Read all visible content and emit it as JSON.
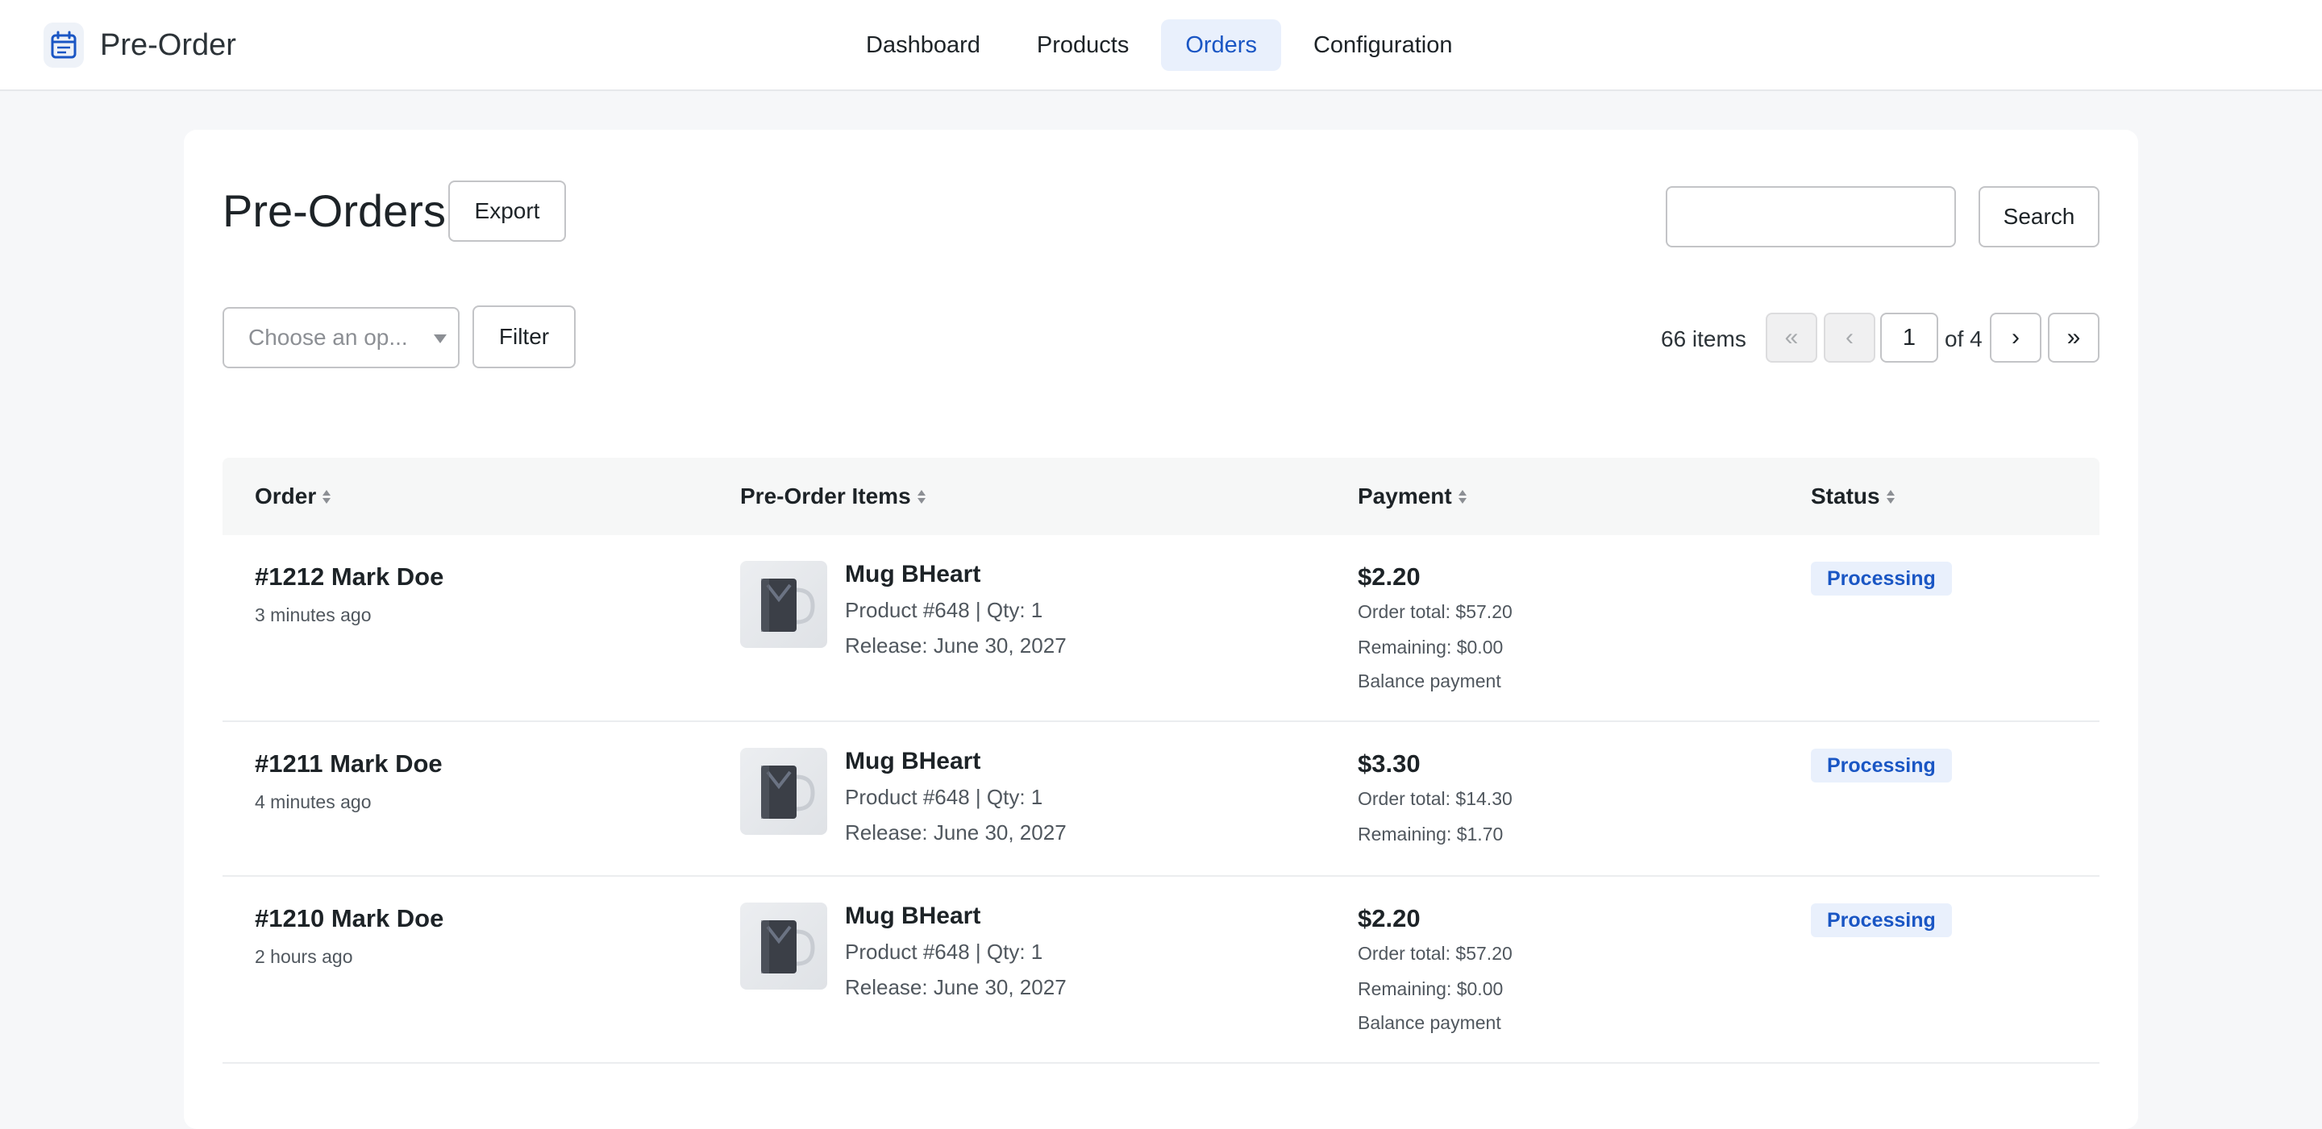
{
  "app": {
    "name": "Pre-Order",
    "icon": "calendar-icon",
    "accent": "#1a56c4"
  },
  "nav": {
    "items": [
      {
        "label": "Dashboard",
        "active": false
      },
      {
        "label": "Products",
        "active": false
      },
      {
        "label": "Orders",
        "active": true
      },
      {
        "label": "Configuration",
        "active": false
      }
    ]
  },
  "page": {
    "title": "Pre-Orders",
    "export_label": "Export",
    "search_placeholder": "",
    "search_label": "Search",
    "filter_placeholder": "Choose an op...",
    "filter_label": "Filter"
  },
  "pagination": {
    "items_count": "66 items",
    "first": "«",
    "prev": "‹",
    "current_page": "1",
    "of_text": "of 4",
    "next": "›",
    "last": "»"
  },
  "table": {
    "headers": [
      "Order",
      "Pre-Order Items",
      "Payment",
      "Status"
    ],
    "rows": [
      {
        "order": "#1212 Mark Doe",
        "time": "3 minutes ago",
        "item_name": "Mug BHeart",
        "item_product": "Product #648 | Qty: 1",
        "item_release": "Release: June 30, 2027",
        "payment": "$2.20",
        "order_total": "Order total: $57.20",
        "remaining": "Remaining: $0.00",
        "balance": "Balance payment",
        "status": "Processing"
      },
      {
        "order": "#1211 Mark Doe",
        "time": "4 minutes ago",
        "item_name": "Mug BHeart",
        "item_product": "Product #648 | Qty: 1",
        "item_release": "Release: June 30, 2027",
        "payment": "$3.30",
        "order_total": "Order total: $14.30",
        "remaining": "Remaining: $1.70",
        "balance": "",
        "status": "Processing"
      },
      {
        "order": "#1210 Mark Doe",
        "time": "2 hours ago",
        "item_name": "Mug BHeart",
        "item_product": "Product #648 | Qty: 1",
        "item_release": "Release: June 30, 2027",
        "payment": "$2.20",
        "order_total": "Order total: $57.20",
        "remaining": "Remaining: $0.00",
        "balance": "Balance payment",
        "status": "Processing"
      }
    ]
  }
}
